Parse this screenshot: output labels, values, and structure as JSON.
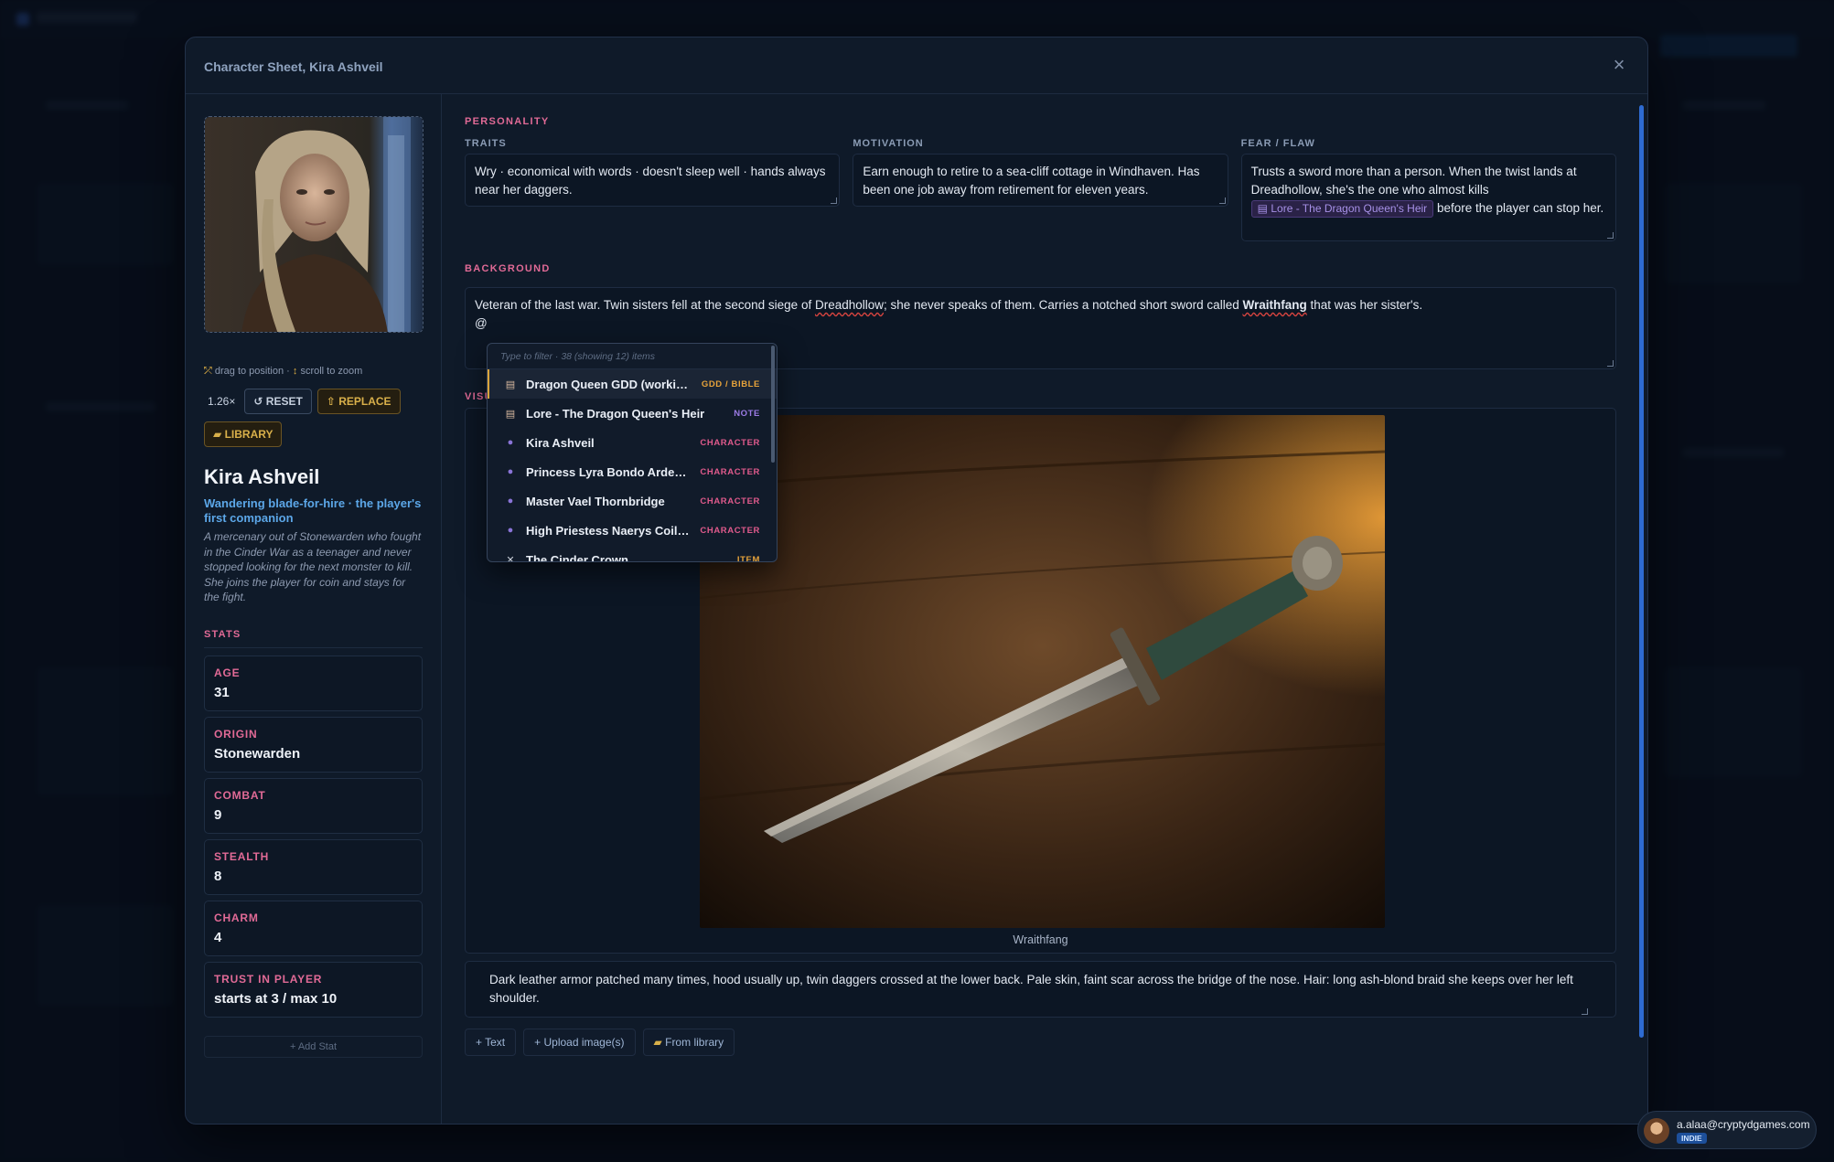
{
  "modal": {
    "title": "Character Sheet, Kira Ashveil",
    "close_icon": "×"
  },
  "portrait": {
    "hint_drag": "drag to position",
    "hint_sep": "·",
    "hint_scroll": "scroll to zoom",
    "zoom": "1.26×",
    "reset_label": "RESET",
    "replace_label": "REPLACE",
    "library_label": "LIBRARY"
  },
  "character": {
    "name": "Kira Ashveil",
    "role": "Wandering blade-for-hire · the player's first companion",
    "description": "A mercenary out of Stonewarden who fought in the Cinder War as a teenager and never stopped looking for the next monster to kill. She joins the player for coin and stays for the fight."
  },
  "stats": {
    "title": "STATS",
    "items": [
      {
        "label": "AGE",
        "value": "31"
      },
      {
        "label": "ORIGIN",
        "value": "Stonewarden"
      },
      {
        "label": "COMBAT",
        "value": "9"
      },
      {
        "label": "STEALTH",
        "value": "8"
      },
      {
        "label": "CHARM",
        "value": "4"
      },
      {
        "label": "TRUST IN PLAYER",
        "value": "starts at 3 / max 10"
      }
    ],
    "add_label": "+ Add Stat"
  },
  "personality": {
    "title": "PERSONALITY",
    "traits_label": "TRAITS",
    "traits": "Wry · economical with words · doesn't sleep well · hands always near her daggers.",
    "motivation_label": "MOTIVATION",
    "motivation": "Earn enough to retire to a sea-cliff cottage in Windhaven. Has been one job away from retirement for eleven years.",
    "fear_label": "FEAR / FLAW",
    "fear_pre": "Trusts a sword more than a person. When the twist lands at Dreadhollow, she's the one who almost kills",
    "fear_ref": "Lore - The Dragon Queen's Heir",
    "fear_post": "before the player can stop her."
  },
  "background": {
    "title": "BACKGROUND",
    "text_1": "Veteran of the last war. Twin sisters fell at the second siege of ",
    "text_place": "Dreadhollow",
    "text_2": "; she never speaks of them. Carries a notched short sword called ",
    "text_sword": "Wraithfang",
    "text_3": " that was her sister's.",
    "mention_trigger": "@"
  },
  "visual": {
    "title": "VISUAL",
    "image_caption": "Wraithfang",
    "description": "Dark leather armor patched many times, hood usually up, twin daggers crossed at the lower back. Pale skin, faint scar across the bridge of the nose. Hair: long ash-blond braid she keeps over her left shoulder.",
    "add_text": "+ Text",
    "add_upload": "+ Upload image(s)",
    "add_library": "From library"
  },
  "mention_dropdown": {
    "filter_placeholder": "Type to filter · 38 (showing 12) items",
    "items": [
      {
        "icon": "document-icon",
        "glyph": "▤",
        "label": "Dragon Queen GDD (working...",
        "type": "GDD / BIBLE",
        "color": "#e7a33b"
      },
      {
        "icon": "note-icon",
        "glyph": "▤",
        "label": "Lore - The Dragon Queen's Heir",
        "type": "NOTE",
        "color": "#9c7be6"
      },
      {
        "icon": "character-icon",
        "glyph": "●",
        "label": "Kira Ashveil",
        "type": "CHARACTER",
        "color": "#e05a8c"
      },
      {
        "icon": "character-icon",
        "glyph": "●",
        "label": "Princess Lyra Bondo Ardenya",
        "type": "CHARACTER",
        "color": "#e05a8c"
      },
      {
        "icon": "character-icon",
        "glyph": "●",
        "label": "Master Vael Thornbridge",
        "type": "CHARACTER",
        "color": "#e05a8c"
      },
      {
        "icon": "character-icon",
        "glyph": "●",
        "label": "High Priestess Naerys Coilbl...",
        "type": "CHARACTER",
        "color": "#e05a8c"
      },
      {
        "icon": "item-icon",
        "glyph": "✕",
        "label": "The Cinder Crown",
        "type": "ITEM",
        "color": "#e7a33b"
      }
    ]
  },
  "user": {
    "email": "a.alaa@cryptydgames.com",
    "plan": "INDIE"
  },
  "colors": {
    "accent_pink": "#e16a96",
    "accent_gold": "#d9b04a",
    "accent_blue": "#5ca7e8",
    "modal_bg": "#0f1a29"
  }
}
